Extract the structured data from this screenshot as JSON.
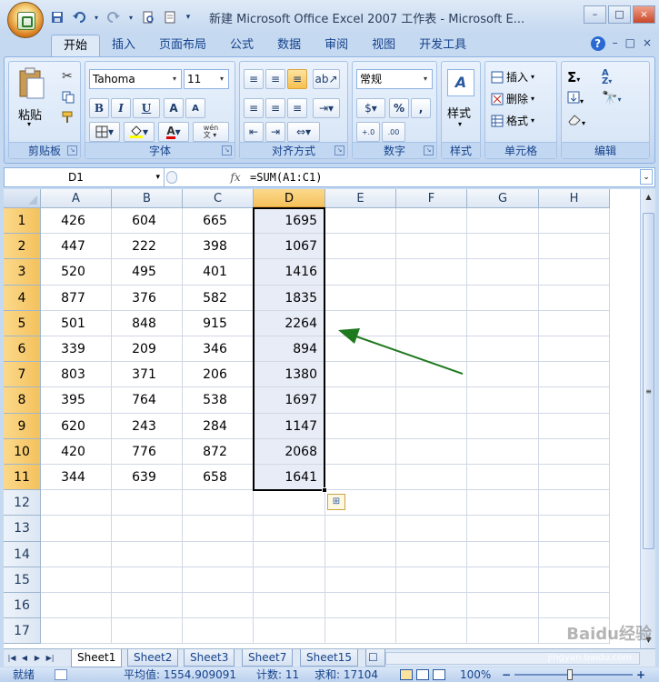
{
  "window": {
    "title": "新建 Microsoft Office Excel 2007 工作表 - Microsoft E...",
    "controls": [
      "–",
      "□",
      "×"
    ]
  },
  "quick_access": {
    "more": "▾"
  },
  "ribbon_tabs": [
    "开始",
    "插入",
    "页面布局",
    "公式",
    "数据",
    "审阅",
    "视图",
    "开发工具"
  ],
  "active_tab": "开始",
  "help": {
    "icon": "?",
    "min": "–",
    "restore": "□",
    "close": "×"
  },
  "ribbon": {
    "clipboard": {
      "label": "剪贴板",
      "paste": "粘贴"
    },
    "font": {
      "label": "字体",
      "name": "Tahoma",
      "size": "11",
      "bold": "B",
      "italic": "I",
      "underline": "U",
      "grow": "A",
      "shrink": "A",
      "color": "A",
      "wen": "wén\n文"
    },
    "alignment": {
      "label": "对齐方式"
    },
    "number": {
      "label": "数字",
      "format": "常规",
      "percent": "%",
      "comma": ",",
      "inc": "+.0\n.00",
      "dec": ".00\n+.0"
    },
    "styles": {
      "label": "样式",
      "button": "样式"
    },
    "cells": {
      "label": "单元格",
      "insert": "插入",
      "delete": "删除",
      "format": "格式"
    },
    "editing": {
      "label": "编辑",
      "sigma": "Σ",
      "sort": "A Z",
      "find": "A"
    }
  },
  "formula_bar": {
    "name_box": "D1",
    "fx": "fx",
    "formula": "=SUM(A1:C1)"
  },
  "columns": [
    "A",
    "B",
    "C",
    "D",
    "E",
    "F",
    "G",
    "H"
  ],
  "rows": [
    "1",
    "2",
    "3",
    "4",
    "5",
    "6",
    "7",
    "8",
    "9",
    "10",
    "11",
    "12",
    "13",
    "14",
    "15",
    "16",
    "17"
  ],
  "data": [
    [
      "426",
      "604",
      "665",
      "1695"
    ],
    [
      "447",
      "222",
      "398",
      "1067"
    ],
    [
      "520",
      "495",
      "401",
      "1416"
    ],
    [
      "877",
      "376",
      "582",
      "1835"
    ],
    [
      "501",
      "848",
      "915",
      "2264"
    ],
    [
      "339",
      "209",
      "346",
      "894"
    ],
    [
      "803",
      "371",
      "206",
      "1380"
    ],
    [
      "395",
      "764",
      "538",
      "1697"
    ],
    [
      "620",
      "243",
      "284",
      "1147"
    ],
    [
      "420",
      "776",
      "872",
      "2068"
    ],
    [
      "344",
      "639",
      "658",
      "1641"
    ]
  ],
  "sheets": [
    "Sheet1",
    "Sheet2",
    "Sheet3",
    "Sheet7",
    "Sheet15"
  ],
  "active_sheet": "Sheet1",
  "status": {
    "ready": "就绪",
    "average": "平均值: 1554.909091",
    "count": "计数: 11",
    "sum": "求和: 17104",
    "zoom": "100%"
  },
  "watermark": {
    "logo": "Baidu经验",
    "url": "jingyan.baidu.com"
  },
  "colors": {
    "accent": "#15428b",
    "selected_header": "#f4c15d",
    "arrow": "#1f7a1f"
  }
}
